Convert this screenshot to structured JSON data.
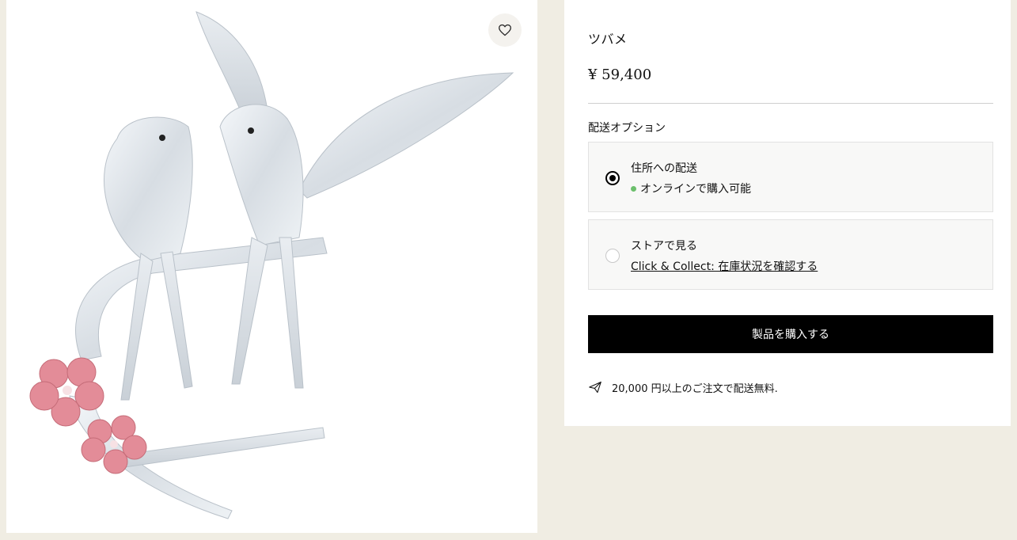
{
  "product": {
    "title": "ツバメ",
    "price": "¥ 59,400",
    "image_alt": "crystal-swallows-figurine"
  },
  "shipping": {
    "label": "配送オプション",
    "options": [
      {
        "title": "住所への配送",
        "status": "オンラインで購入可能",
        "selected": true
      },
      {
        "title": "ストアで見る",
        "link": "Click & Collect: 在庫状況を確認する",
        "selected": false
      }
    ]
  },
  "actions": {
    "buy_label": "製品を購入する"
  },
  "notice": {
    "free_shipping": "20,000 円以上のご注文で配送無料."
  },
  "icons": {
    "wishlist": "heart-icon",
    "shipping": "paper-plane-icon"
  },
  "colors": {
    "background": "#f0ede3",
    "button": "#000000",
    "available": "#6cbf6c",
    "flower": "#e38c98"
  }
}
